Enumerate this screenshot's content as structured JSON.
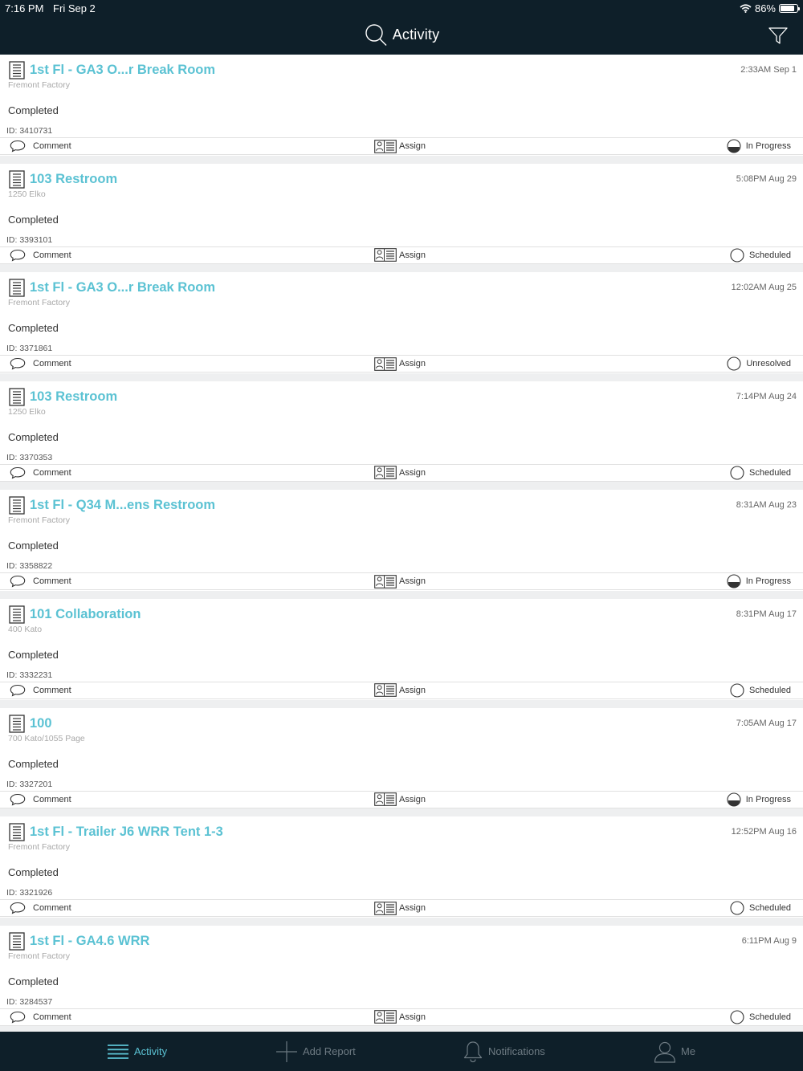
{
  "status_bar": {
    "time": "7:16 PM",
    "date": "Fri Sep 2",
    "battery": "86%",
    "battery_level": 0.86
  },
  "header": {
    "title": "Activity",
    "search_icon": "search-icon",
    "filter_icon": "filter-icon"
  },
  "actions": {
    "comment_label": "Comment",
    "assign_label": "Assign"
  },
  "activities": [
    {
      "title": "1st Fl - GA3 O...r Break Room",
      "location": "Fremont Factory",
      "time": "2:33AM Sep 1",
      "status": "Completed",
      "id": "ID: 3410731",
      "state": "In Progress",
      "state_icon": "half-circle"
    },
    {
      "title": "103 Restroom",
      "location": "1250 Elko",
      "time": "5:08PM Aug 29",
      "status": "Completed",
      "id": "ID: 3393101",
      "state": "Scheduled",
      "state_icon": "circle"
    },
    {
      "title": "1st Fl - GA3 O...r Break Room",
      "location": "Fremont Factory",
      "time": "12:02AM Aug 25",
      "status": "Completed",
      "id": "ID: 3371861",
      "state": "Unresolved",
      "state_icon": "circle"
    },
    {
      "title": "103 Restroom",
      "location": "1250 Elko",
      "time": "7:14PM Aug 24",
      "status": "Completed",
      "id": "ID: 3370353",
      "state": "Scheduled",
      "state_icon": "circle"
    },
    {
      "title": "1st Fl - Q34 M...ens Restroom",
      "location": "Fremont Factory",
      "time": "8:31AM Aug 23",
      "status": "Completed",
      "id": "ID: 3358822",
      "state": "In Progress",
      "state_icon": "half-circle"
    },
    {
      "title": "101 Collaboration",
      "location": "400 Kato",
      "time": "8:31PM Aug 17",
      "status": "Completed",
      "id": "ID: 3332231",
      "state": "Scheduled",
      "state_icon": "circle"
    },
    {
      "title": "100",
      "location": "700 Kato/1055 Page",
      "time": "7:05AM Aug 17",
      "status": "Completed",
      "id": "ID: 3327201",
      "state": "In Progress",
      "state_icon": "half-circle"
    },
    {
      "title": "1st Fl - Trailer J6 WRR Tent 1-3",
      "location": "Fremont Factory",
      "time": "12:52PM Aug 16",
      "status": "Completed",
      "id": "ID: 3321926",
      "state": "Scheduled",
      "state_icon": "circle"
    },
    {
      "title": "1st Fl - GA4.6 WRR",
      "location": "Fremont Factory",
      "time": "6:11PM Aug 9",
      "status": "Completed",
      "id": "ID: 3284537",
      "state": "Scheduled",
      "state_icon": "circle"
    }
  ],
  "tabs": [
    {
      "label": "Activity",
      "icon": "list-icon",
      "active": true
    },
    {
      "label": "Add Report",
      "icon": "plus-icon",
      "active": false
    },
    {
      "label": "Notifications",
      "icon": "bell-icon",
      "active": false
    },
    {
      "label": "Me",
      "icon": "person-icon",
      "active": false
    }
  ]
}
